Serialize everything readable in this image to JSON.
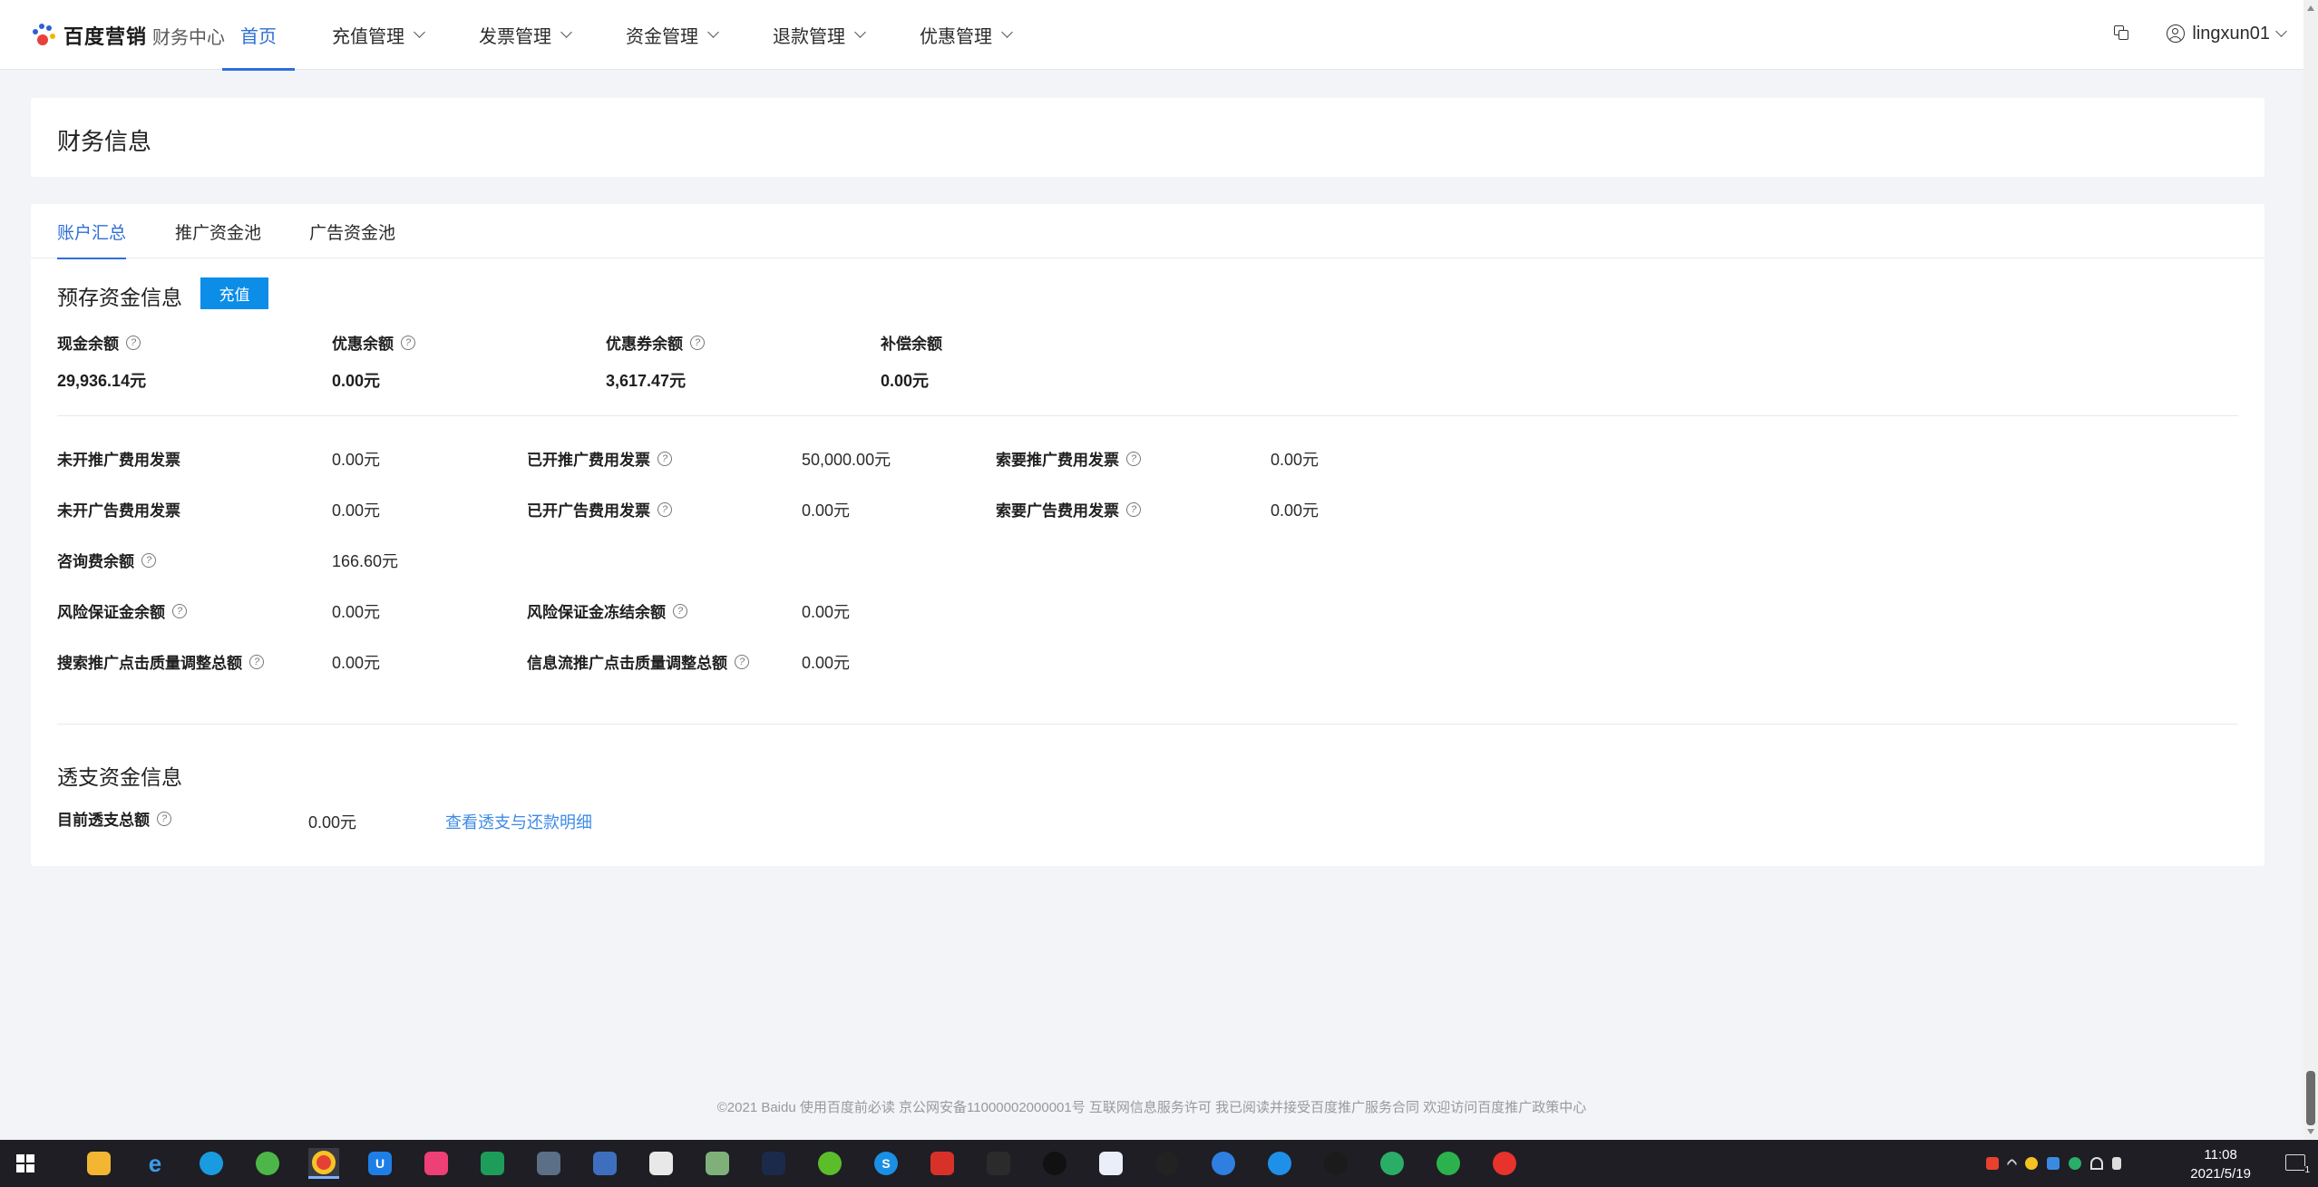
{
  "nav": {
    "brand": "百度营销",
    "sub_brand": "财务中心",
    "items": [
      {
        "label": "首页"
      },
      {
        "label": "充值管理"
      },
      {
        "label": "发票管理"
      },
      {
        "label": "资金管理"
      },
      {
        "label": "退款管理"
      },
      {
        "label": "优惠管理"
      }
    ],
    "user": "lingxun01"
  },
  "page_title": "财务信息",
  "tabs": [
    "账户汇总",
    "推广资金池",
    "广告资金池"
  ],
  "prepaid": {
    "title": "预存资金信息",
    "recharge_button": "充值",
    "cash_balance_label": "现金余额",
    "cash_balance_value": "29,936.14元",
    "discount_balance_label": "优惠余额",
    "discount_balance_value": "0.00元",
    "coupon_balance_label": "优惠券余额",
    "coupon_balance_value": "3,617.47元",
    "compensation_balance_label": "补偿余额",
    "compensation_balance_value": "0.00元"
  },
  "details": {
    "unissued_promo_invoice_label": "未开推广费用发票",
    "unissued_promo_invoice_value": "0.00元",
    "issued_promo_invoice_label": "已开推广费用发票",
    "issued_promo_invoice_value": "50,000.00元",
    "request_promo_invoice_label": "索要推广费用发票",
    "request_promo_invoice_value": "0.00元",
    "unissued_ad_invoice_label": "未开广告费用发票",
    "unissued_ad_invoice_value": "0.00元",
    "issued_ad_invoice_label": "已开广告费用发票",
    "issued_ad_invoice_value": "0.00元",
    "request_ad_invoice_label": "索要广告费用发票",
    "request_ad_invoice_value": "0.00元",
    "consulting_fee_label": "咨询费余额",
    "consulting_fee_value": "166.60元",
    "risk_deposit_label": "风险保证金余额",
    "risk_deposit_value": "0.00元",
    "risk_deposit_frozen_label": "风险保证金冻结余额",
    "risk_deposit_frozen_value": "0.00元",
    "search_quality_adj_label": "搜索推广点击质量调整总额",
    "search_quality_adj_value": "0.00元",
    "feed_quality_adj_label": "信息流推广点击质量调整总额",
    "feed_quality_adj_value": "0.00元"
  },
  "overdraft": {
    "title": "透支资金信息",
    "total_label": "目前透支总额",
    "total_value": "0.00元",
    "detail_link": "查看透支与还款明细"
  },
  "footer": "©2021 Baidu 使用百度前必读 京公网安备11000002000001号 互联网信息服务许可 我已阅读并接受百度推广服务合同 欢迎访问百度推广政策中心",
  "taskbar": {
    "time": "11:08",
    "date": "2021/5/19",
    "notification_count": "1"
  },
  "colors": {
    "accent": "#2f6fd6",
    "button": "#0b8de8",
    "link": "#3d8be6",
    "page_bg": "#f2f4f8"
  }
}
